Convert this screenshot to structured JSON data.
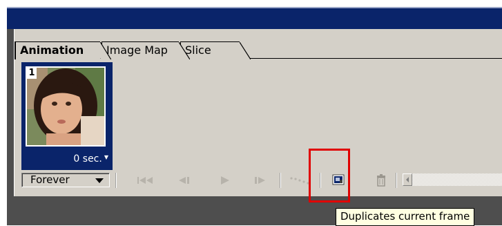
{
  "tabs": [
    {
      "label": "Animation",
      "active": true
    },
    {
      "label": "Image Map",
      "active": false
    },
    {
      "label": "Slice",
      "active": false
    }
  ],
  "frame": {
    "number": "1",
    "delay": "0 sec.",
    "thumbnail": "child-portrait-photo"
  },
  "controls": {
    "loop_value": "Forever",
    "buttons": [
      {
        "name": "select-first-frame-icon"
      },
      {
        "name": "select-previous-frame-icon"
      },
      {
        "name": "play-icon"
      },
      {
        "name": "select-next-frame-icon"
      },
      {
        "name": "tween-icon"
      },
      {
        "name": "duplicate-frame-icon"
      },
      {
        "name": "trash-icon"
      }
    ]
  },
  "tooltip": {
    "text": "Duplicates current frame"
  },
  "colors": {
    "titlebar": "#0a246a",
    "panel": "#d4d0c8",
    "selected_frame": "#0a246a",
    "highlight": "#e00000",
    "tooltip_bg": "#ffffe1"
  }
}
